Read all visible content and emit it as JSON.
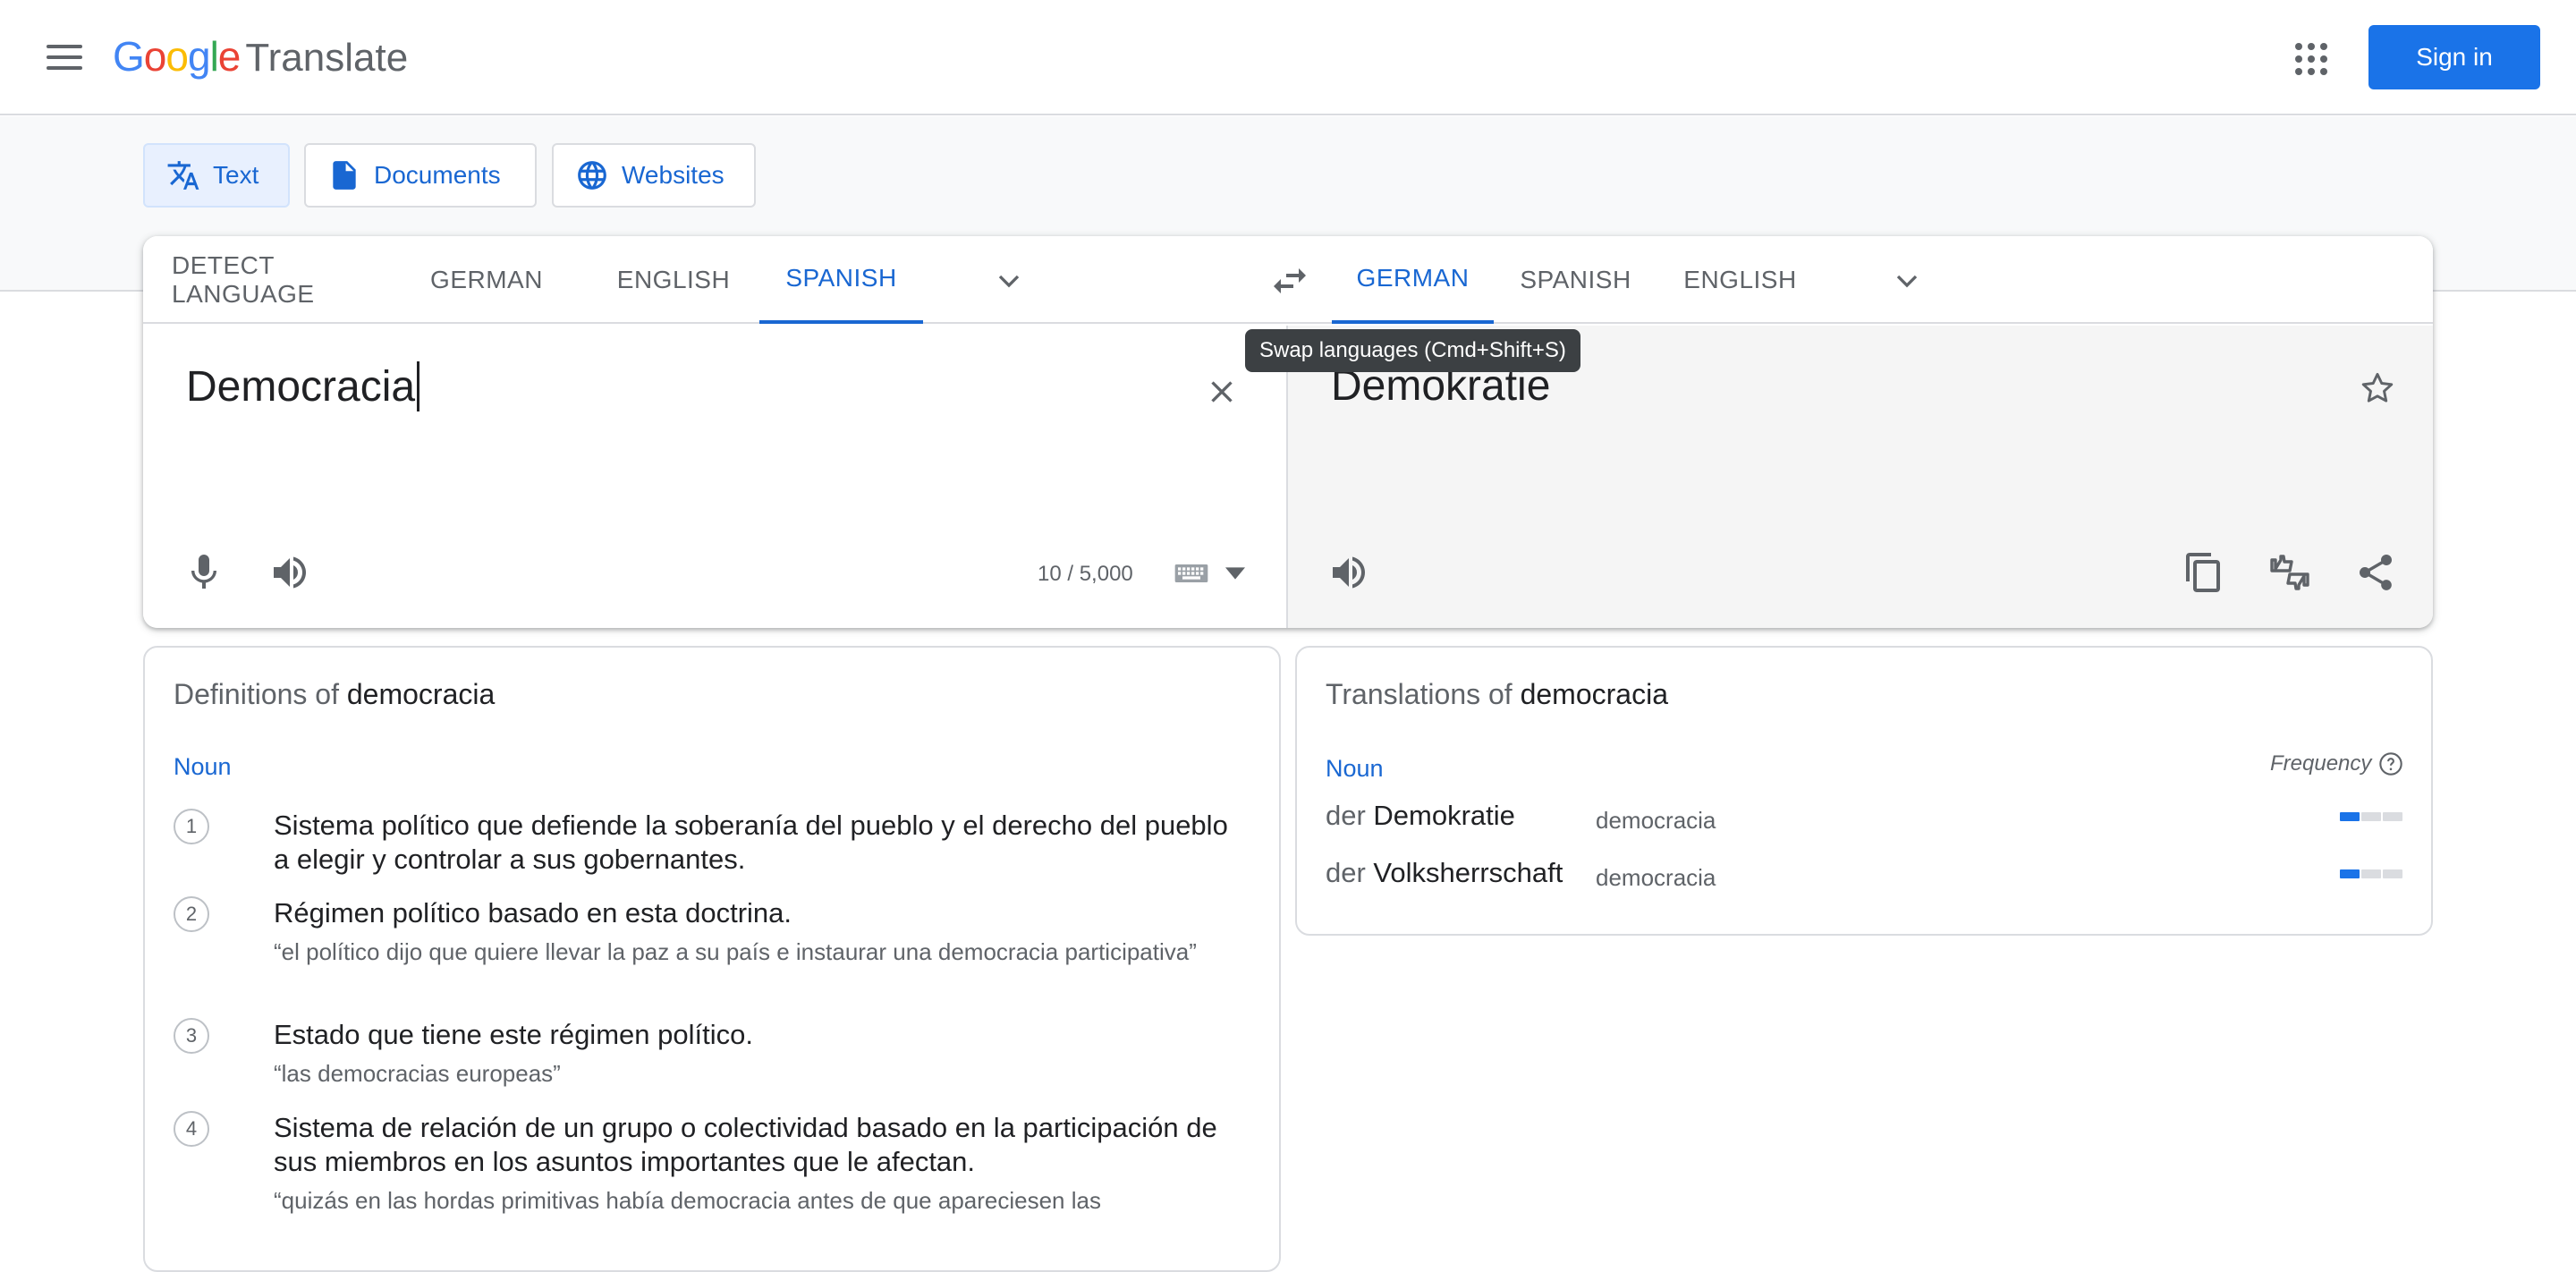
{
  "header": {
    "logo_letters": [
      {
        "ch": "G",
        "color": "#4285F4"
      },
      {
        "ch": "o",
        "color": "#EA4335"
      },
      {
        "ch": "o",
        "color": "#FBBC05"
      },
      {
        "ch": "g",
        "color": "#4285F4"
      },
      {
        "ch": "l",
        "color": "#34A853"
      },
      {
        "ch": "e",
        "color": "#EA4335"
      }
    ],
    "product": "Translate",
    "signin_label": "Sign in"
  },
  "modes": [
    {
      "label": "Text",
      "icon": "translate-icon",
      "active": true
    },
    {
      "label": "Documents",
      "icon": "document-icon",
      "active": false
    },
    {
      "label": "Websites",
      "icon": "globe-icon",
      "active": false
    }
  ],
  "source_langs": [
    {
      "label": "DETECT LANGUAGE",
      "active": false
    },
    {
      "label": "GERMAN",
      "active": false
    },
    {
      "label": "ENGLISH",
      "active": false
    },
    {
      "label": "SPANISH",
      "active": true
    }
  ],
  "target_langs": [
    {
      "label": "GERMAN",
      "active": true
    },
    {
      "label": "SPANISH",
      "active": false
    },
    {
      "label": "ENGLISH",
      "active": false
    }
  ],
  "tooltip": "Swap languages (Cmd+Shift+S)",
  "source": {
    "text": "Democracia",
    "char_count": "10 / 5,000"
  },
  "target": {
    "text": "Demokratie"
  },
  "definitions": {
    "title_prefix": "Definitions of",
    "word": "democracia",
    "pos": "Noun",
    "items": [
      {
        "num": "1",
        "text": "Sistema político que defiende la soberanía del pueblo y el derecho del pueblo a elegir y controlar a sus gobernantes.",
        "example": ""
      },
      {
        "num": "2",
        "text": "Régimen político basado en esta doctrina.",
        "example": "“el político dijo que quiere llevar la paz a su país e instaurar una democracia participativa”"
      },
      {
        "num": "3",
        "text": "Estado que tiene este régimen político.",
        "example": "“las democracias europeas”"
      },
      {
        "num": "4",
        "text": "Sistema de relación de un grupo o colectividad basado en la participación de sus miembros en los asuntos importantes que le afectan.",
        "example": "“quizás en las hordas primitivas había democracia antes de que apareciesen las"
      }
    ]
  },
  "translations": {
    "title_prefix": "Translations of",
    "word": "democracia",
    "pos": "Noun",
    "frequency_label": "Frequency",
    "rows": [
      {
        "article": "der",
        "word": "Demokratie",
        "synonym": "democracia",
        "frequency": 1
      },
      {
        "article": "der",
        "word": "Volksherrschaft",
        "synonym": "democracia",
        "frequency": 1
      }
    ]
  }
}
